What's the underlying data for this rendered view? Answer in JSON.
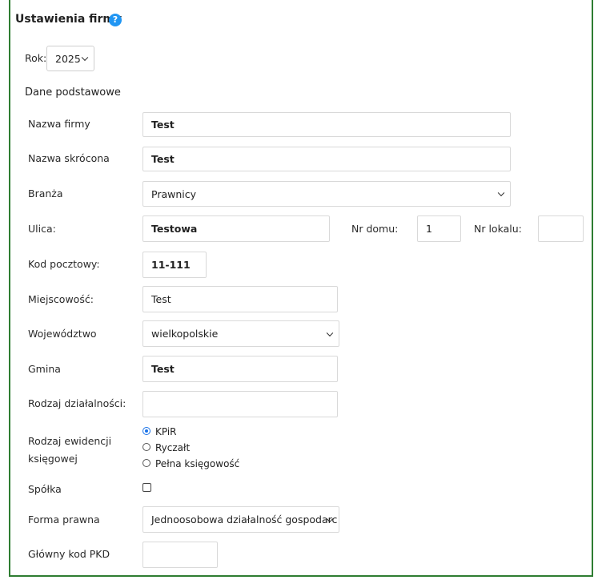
{
  "header": {
    "title": "Ustawienia firmy",
    "help_icon": "?"
  },
  "year": {
    "label": "Rok:",
    "value": "2025"
  },
  "section_title": "Dane podstawowe",
  "fields": {
    "company_name": {
      "label": "Nazwa firmy",
      "value": "Test"
    },
    "short_name": {
      "label": "Nazwa skrócona",
      "value": "Test"
    },
    "industry": {
      "label": "Branża",
      "value": "Prawnicy"
    },
    "street": {
      "label": "Ulica:",
      "value": "Testowa"
    },
    "house_no": {
      "label": "Nr domu:",
      "value": "1"
    },
    "flat_no": {
      "label": "Nr lokalu:",
      "value": ""
    },
    "postal_code": {
      "label": "Kod pocztowy:",
      "value": "11-111"
    },
    "city": {
      "label": "Miejscowość:",
      "value": "Test"
    },
    "voivodeship": {
      "label": "Województwo",
      "value": "wielkopolskie"
    },
    "commune": {
      "label": "Gmina",
      "value": "Test"
    },
    "activity_type": {
      "label": "Rodzaj działalności:",
      "value": ""
    },
    "accounting_type": {
      "label_line1": "Rodzaj ewidencji",
      "label_line2": "księgowej",
      "options": [
        "KPiR",
        "Ryczałt",
        "Pełna księgowość"
      ],
      "selected": "KPiR"
    },
    "company_partnership": {
      "label": "Spółka",
      "checked": false
    },
    "legal_form": {
      "label": "Forma prawna",
      "value": "Jednoosobowa działalność gospodarc"
    },
    "main_pkd": {
      "label": "Główny kod PKD",
      "value": ""
    }
  },
  "colors": {
    "border": "#2e7d32",
    "help": "#2196f3",
    "radio_selected": "#1a73e8"
  }
}
